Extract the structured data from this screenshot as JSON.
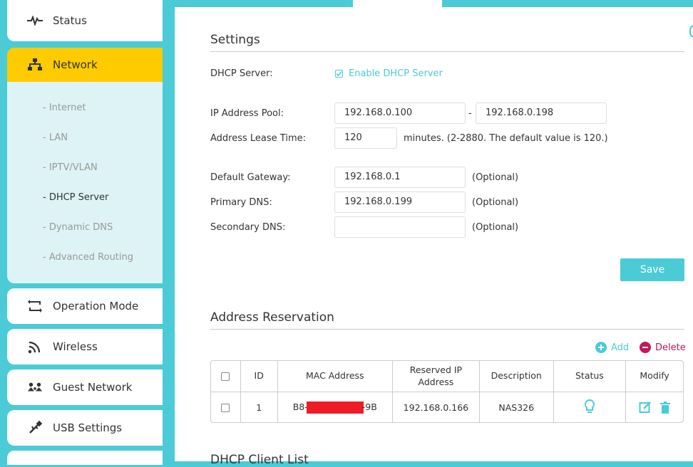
{
  "colors": {
    "accent": "#4acbd6",
    "active_nav": "#fecb00",
    "submenu_bg": "#def3f6",
    "delete": "#c2185b",
    "redaction": "#ee1c24"
  },
  "sidebar": {
    "status": {
      "label": "Status",
      "icon": "pulse-icon"
    },
    "network": {
      "label": "Network",
      "icon": "network-icon"
    },
    "sub_items": [
      {
        "label": "- Internet"
      },
      {
        "label": "- LAN"
      },
      {
        "label": "- IPTV/VLAN"
      },
      {
        "label": "- DHCP Server"
      },
      {
        "label": "- Dynamic DNS"
      },
      {
        "label": "- Advanced Routing"
      }
    ],
    "operation_mode": {
      "label": "Operation Mode",
      "icon": "swap-icon"
    },
    "wireless": {
      "label": "Wireless",
      "icon": "wifi-icon"
    },
    "guest_network": {
      "label": "Guest Network",
      "icon": "guest-icon"
    },
    "usb_settings": {
      "label": "USB Settings",
      "icon": "usb-icon"
    }
  },
  "settings": {
    "title": "Settings",
    "dhcp_server_label": "DHCP Server:",
    "enable_dhcp_label": "Enable DHCP Server",
    "enable_dhcp_checked": true,
    "ip_pool_label": "IP Address Pool:",
    "ip_pool_start": "192.168.0.100",
    "ip_pool_sep": "-",
    "ip_pool_end": "192.168.0.198",
    "lease_label": "Address Lease Time:",
    "lease_value": "120",
    "lease_hint": "minutes. (2-2880. The default value is 120.)",
    "gateway_label": "Default Gateway:",
    "gateway_value": "192.168.0.1",
    "primary_dns_label": "Primary DNS:",
    "primary_dns_value": "192.168.0.199",
    "secondary_dns_label": "Secondary DNS:",
    "secondary_dns_value": "",
    "optional": "(Optional)",
    "save_label": "Save"
  },
  "reservation": {
    "title": "Address Reservation",
    "add_label": "Add",
    "delete_label": "Delete",
    "columns": [
      "ID",
      "MAC Address",
      "Reserved IP Address",
      "Description",
      "Status",
      "Modify"
    ],
    "rows": [
      {
        "id": "1",
        "mac_prefix": "B8-",
        "mac_suffix": "-9B",
        "ip": "192.168.0.166",
        "description": "NAS326"
      }
    ]
  },
  "client_list": {
    "title": "DHCP Client List"
  }
}
